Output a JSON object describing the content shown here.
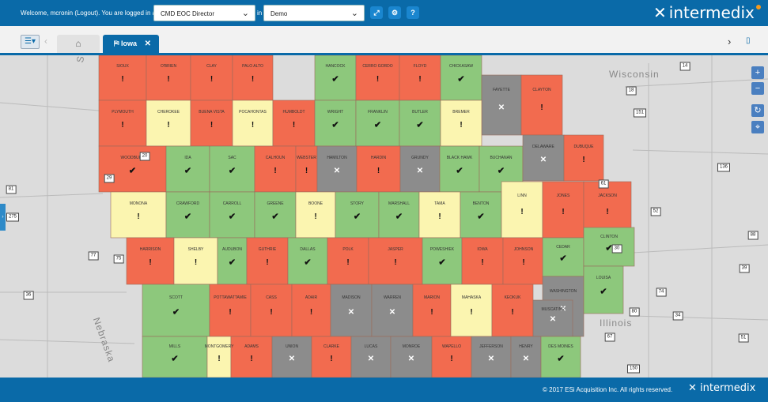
{
  "header": {
    "welcome_prefix": "Welcome, mcronin (",
    "logout_label": "Logout",
    "welcome_suffix": "). You are logged in as",
    "role_value": "CMD EOC Director",
    "in_label": "in",
    "context_value": "Demo",
    "logo_text": "intermedix"
  },
  "tabs": {
    "current_tab": "Iowa"
  },
  "map": {
    "labels": {
      "wisconsin": "Wisconsin",
      "illinois": "Illinois",
      "nebraska": "Nebraska",
      "sd": "S. Da"
    },
    "status_colors": {
      "red": "#f26b4f",
      "green": "#8dc87c",
      "yellow": "#fbf5b0",
      "gray": "#8c8c8c"
    },
    "counties": [
      {
        "name": "SIOUX",
        "status": "red",
        "mark": "bang"
      },
      {
        "name": "O'BRIEN",
        "status": "red",
        "mark": "bang"
      },
      {
        "name": "CLAY",
        "status": "red",
        "mark": "bang"
      },
      {
        "name": "PALO ALTO",
        "status": "red",
        "mark": "bang"
      },
      {
        "name": "HANCOCK",
        "status": "green",
        "mark": "check"
      },
      {
        "name": "CERRO GORDO",
        "status": "red",
        "mark": "bang"
      },
      {
        "name": "FLOYD",
        "status": "red",
        "mark": "bang"
      },
      {
        "name": "CHICKASAW",
        "status": "green",
        "mark": "check"
      },
      {
        "name": "FAYETTE",
        "status": "gray",
        "mark": "cross"
      },
      {
        "name": "CLAYTON",
        "status": "red",
        "mark": "bang"
      },
      {
        "name": "PLYMOUTH",
        "status": "red",
        "mark": "bang"
      },
      {
        "name": "CHEROKEE",
        "status": "yellow",
        "mark": "bang"
      },
      {
        "name": "BUENA VISTA",
        "status": "red",
        "mark": "bang"
      },
      {
        "name": "POCAHONTAS",
        "status": "yellow",
        "mark": "bang"
      },
      {
        "name": "HUMBOLDT",
        "status": "red",
        "mark": "bang"
      },
      {
        "name": "WRIGHT",
        "status": "green",
        "mark": "check"
      },
      {
        "name": "FRANKLIN",
        "status": "green",
        "mark": "check"
      },
      {
        "name": "BUTLER",
        "status": "green",
        "mark": "check"
      },
      {
        "name": "BREMER",
        "status": "yellow",
        "mark": "bang"
      },
      {
        "name": "WOODBURY",
        "status": "red",
        "mark": "check"
      },
      {
        "name": "IDA",
        "status": "green",
        "mark": "check"
      },
      {
        "name": "SAC",
        "status": "green",
        "mark": "check"
      },
      {
        "name": "CALHOUN",
        "status": "red",
        "mark": "bang"
      },
      {
        "name": "WEBSTER",
        "status": "red",
        "mark": "bang"
      },
      {
        "name": "HAMILTON",
        "status": "gray",
        "mark": "cross"
      },
      {
        "name": "HARDIN",
        "status": "red",
        "mark": "bang"
      },
      {
        "name": "GRUNDY",
        "status": "gray",
        "mark": "cross"
      },
      {
        "name": "BLACK HAWK",
        "status": "green",
        "mark": "check"
      },
      {
        "name": "BUCHANAN",
        "status": "green",
        "mark": "check"
      },
      {
        "name": "DELAWARE",
        "status": "gray",
        "mark": "cross"
      },
      {
        "name": "DUBUQUE",
        "status": "red",
        "mark": "bang"
      },
      {
        "name": "MONONA",
        "status": "yellow",
        "mark": "bang"
      },
      {
        "name": "CRAWFORD",
        "status": "green",
        "mark": "check"
      },
      {
        "name": "CARROLL",
        "status": "green",
        "mark": "check"
      },
      {
        "name": "GREENE",
        "status": "green",
        "mark": "check"
      },
      {
        "name": "BOONE",
        "status": "yellow",
        "mark": "bang"
      },
      {
        "name": "STORY",
        "status": "green",
        "mark": "check"
      },
      {
        "name": "MARSHALL",
        "status": "green",
        "mark": "check"
      },
      {
        "name": "TAMA",
        "status": "yellow",
        "mark": "bang"
      },
      {
        "name": "BENTON",
        "status": "green",
        "mark": "check"
      },
      {
        "name": "LINN",
        "status": "yellow",
        "mark": "bang"
      },
      {
        "name": "JONES",
        "status": "red",
        "mark": "bang"
      },
      {
        "name": "JACKSON",
        "status": "red",
        "mark": "bang"
      },
      {
        "name": "HARRISON",
        "status": "red",
        "mark": "bang"
      },
      {
        "name": "SHELBY",
        "status": "yellow",
        "mark": "bang"
      },
      {
        "name": "AUDUBON",
        "status": "green",
        "mark": "check"
      },
      {
        "name": "GUTHRIE",
        "status": "red",
        "mark": "bang"
      },
      {
        "name": "DALLAS",
        "status": "green",
        "mark": "check"
      },
      {
        "name": "POLK",
        "status": "red",
        "mark": "bang"
      },
      {
        "name": "JASPER",
        "status": "red",
        "mark": "bang"
      },
      {
        "name": "POWESHIEK",
        "status": "green",
        "mark": "check"
      },
      {
        "name": "IOWA",
        "status": "red",
        "mark": "bang"
      },
      {
        "name": "JOHNSON",
        "status": "red",
        "mark": "bang"
      },
      {
        "name": "CEDAR",
        "status": "green",
        "mark": "check"
      },
      {
        "name": "CLINTON",
        "status": "green",
        "mark": "check"
      },
      {
        "name": "SCOTT",
        "status": "green",
        "mark": "check"
      },
      {
        "name": "POTTAWATTAMIE",
        "status": "red",
        "mark": "bang"
      },
      {
        "name": "CASS",
        "status": "red",
        "mark": "bang"
      },
      {
        "name": "ADAIR",
        "status": "red",
        "mark": "bang"
      },
      {
        "name": "MADISON",
        "status": "gray",
        "mark": "cross"
      },
      {
        "name": "WARREN",
        "status": "gray",
        "mark": "cross"
      },
      {
        "name": "MARION",
        "status": "red",
        "mark": "bang"
      },
      {
        "name": "MAHASKA",
        "status": "yellow",
        "mark": "bang"
      },
      {
        "name": "KEOKUK",
        "status": "red",
        "mark": "bang"
      },
      {
        "name": "WASHINGTON",
        "status": "gray",
        "mark": "cross"
      },
      {
        "name": "MUSCATINE",
        "status": "gray",
        "mark": "cross"
      },
      {
        "name": "LOUISA",
        "status": "green",
        "mark": "check"
      },
      {
        "name": "MILLS",
        "status": "green",
        "mark": "check"
      },
      {
        "name": "MONTGOMERY",
        "status": "yellow",
        "mark": "bang"
      },
      {
        "name": "ADAMS",
        "status": "red",
        "mark": "bang"
      },
      {
        "name": "UNION",
        "status": "gray",
        "mark": "cross"
      },
      {
        "name": "CLARKE",
        "status": "red",
        "mark": "bang"
      },
      {
        "name": "LUCAS",
        "status": "gray",
        "mark": "cross"
      },
      {
        "name": "MONROE",
        "status": "gray",
        "mark": "cross"
      },
      {
        "name": "WAPELLO",
        "status": "red",
        "mark": "bang"
      },
      {
        "name": "JEFFERSON",
        "status": "gray",
        "mark": "cross"
      },
      {
        "name": "HENRY",
        "status": "gray",
        "mark": "cross"
      },
      {
        "name": "DES MOINES",
        "status": "green",
        "mark": "check"
      }
    ],
    "shields": [
      "14",
      "18",
      "151",
      "20",
      "52",
      "61",
      "136",
      "30",
      "88",
      "81",
      "275",
      "77",
      "75",
      "80",
      "34",
      "39",
      "74",
      "67",
      "150",
      "36",
      "51",
      "29"
    ]
  },
  "footer": {
    "copyright": "© 2017 ESi Acquisition Inc. All rights reserved.",
    "logo_text": "intermedix"
  }
}
